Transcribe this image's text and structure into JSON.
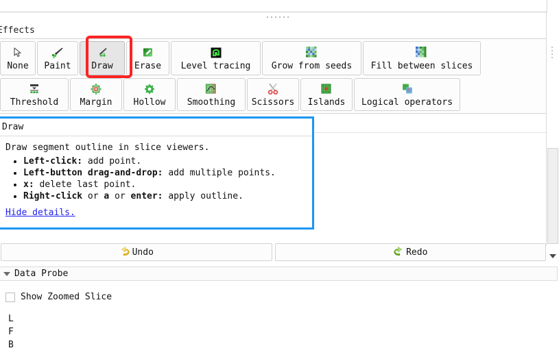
{
  "window": {
    "splitter": "splitter-handle"
  },
  "effects": {
    "section_label": "Effects",
    "selected": "Draw",
    "highlight_color": "#fb2323",
    "row1": [
      {
        "label": "None",
        "icon": "cursor-arrow-icon"
      },
      {
        "label": "Paint",
        "icon": "paintbrush-icon"
      },
      {
        "label": "Draw",
        "icon": "pencil-draw-icon"
      },
      {
        "label": "Erase",
        "icon": "eraser-icon"
      },
      {
        "label": "Level tracing",
        "icon": "level-tracing-icon"
      },
      {
        "label": "Grow from seeds",
        "icon": "grow-from-seeds-icon"
      },
      {
        "label": "Fill between slices",
        "icon": "fill-between-slices-icon"
      }
    ],
    "row2": [
      {
        "label": "Threshold",
        "icon": "threshold-icon"
      },
      {
        "label": "Margin",
        "icon": "margin-icon"
      },
      {
        "label": "Hollow",
        "icon": "hollow-icon"
      },
      {
        "label": "Smoothing",
        "icon": "smoothing-icon"
      },
      {
        "label": "Scissors",
        "icon": "scissors-icon"
      },
      {
        "label": "Islands",
        "icon": "islands-icon"
      },
      {
        "label": "Logical operators",
        "icon": "logical-operators-icon"
      }
    ]
  },
  "details": {
    "title": "Draw",
    "intro": "Draw segment outline in slice viewers.",
    "items": [
      {
        "key": "Left-click:",
        "rest": " add point."
      },
      {
        "key": "Left-button drag-and-drop:",
        "rest": " add multiple points."
      },
      {
        "key": "x:",
        "rest": " delete last point."
      },
      {
        "key": "Right-click",
        "mid": " or ",
        "key2": "a",
        "mid2": " or ",
        "key3": "enter:",
        "rest": " apply outline."
      }
    ],
    "hide_link": "Hide details.",
    "border_color": "#1b96f3"
  },
  "history": {
    "undo_label": "Undo",
    "undo_icon": "undo-arrow-icon",
    "undo_color": "#f0c419",
    "redo_label": "Redo",
    "redo_icon": "redo-arrow-icon",
    "redo_color": "#7cc142"
  },
  "data_probe": {
    "title": "Data Probe",
    "collapsed_icon": "triangle-down-icon",
    "show_zoomed_slice_label": "Show Zoomed Slice",
    "show_zoomed_slice_checked": false,
    "lines": [
      "L",
      "F",
      "B"
    ]
  },
  "scrollbar": {
    "down_arrow_icon": "triangle-down-icon"
  }
}
